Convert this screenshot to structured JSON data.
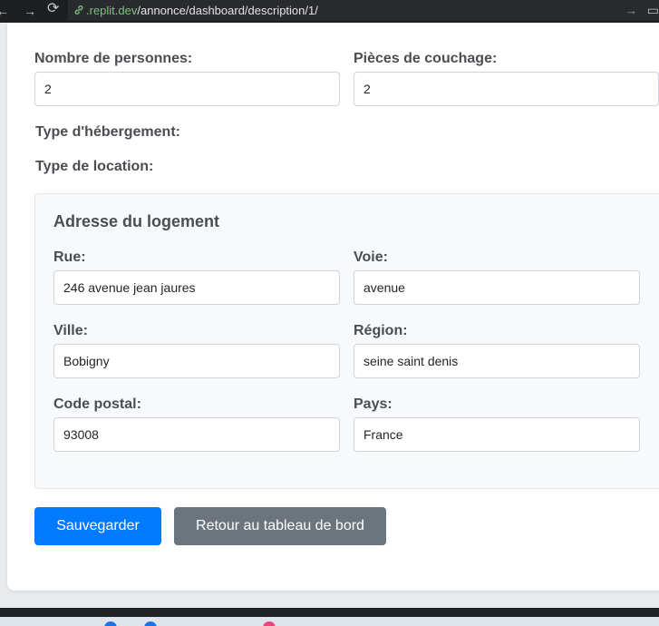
{
  "browser": {
    "url_domain": ".replit.dev",
    "url_path": "/annonce/dashboard/description/1/",
    "back_icon": "←",
    "forward_icon": "→",
    "reload_icon": "⟳",
    "go_icon": "→",
    "monitor_icon": "▭"
  },
  "form": {
    "nombre_personnes_label": "Nombre de personnes:",
    "nombre_personnes_value": "2",
    "pieces_couchage_label": "Pièces de couchage:",
    "pieces_couchage_value": "2",
    "type_hebergement_label": "Type d'hébergement:",
    "type_location_label": "Type de location:"
  },
  "address": {
    "title": "Adresse du logement",
    "rue_label": "Rue:",
    "rue_value": "246 avenue jean jaures",
    "voie_label": "Voie:",
    "voie_value": "avenue",
    "ville_label": "Ville:",
    "ville_value": "Bobigny",
    "region_label": "Région:",
    "region_value": "seine saint denis",
    "code_postal_label": "Code postal:",
    "code_postal_value": "93008",
    "pays_label": "Pays:",
    "pays_value": "France"
  },
  "actions": {
    "save_label": "Sauvegarder",
    "back_label": "Retour au tableau de bord"
  },
  "colors": {
    "primary": "#007bff",
    "secondary": "#6c757d",
    "label": "#4a4d52"
  }
}
